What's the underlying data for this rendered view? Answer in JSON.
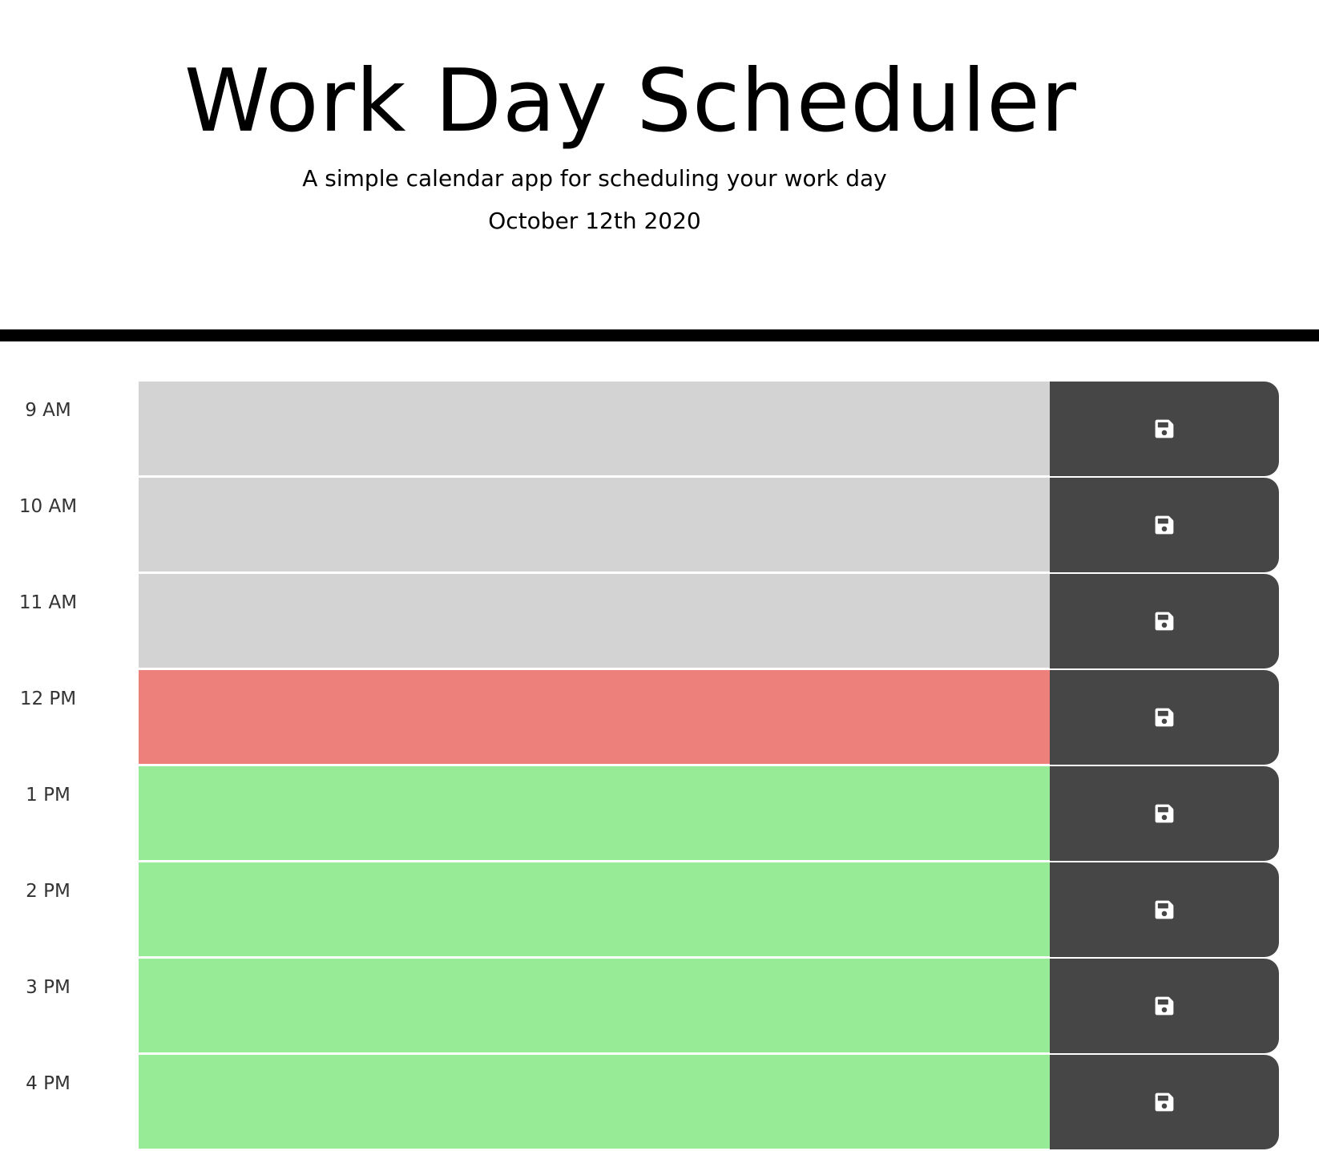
{
  "header": {
    "title": "Work Day Scheduler",
    "subtitle": "A simple calendar app for scheduling your work day",
    "current_day": "October 12th 2020"
  },
  "colors": {
    "past": "#d3d3d3",
    "present": "#ee807c",
    "future": "#97eb97",
    "save_button": "#464646"
  },
  "schedule": {
    "save_icon": "save-icon",
    "blocks": [
      {
        "hour": "9 AM",
        "text": "",
        "status": "past"
      },
      {
        "hour": "10 AM",
        "text": "",
        "status": "past"
      },
      {
        "hour": "11 AM",
        "text": "",
        "status": "past"
      },
      {
        "hour": "12 PM",
        "text": "",
        "status": "present"
      },
      {
        "hour": "1 PM",
        "text": "",
        "status": "future"
      },
      {
        "hour": "2 PM",
        "text": "",
        "status": "future"
      },
      {
        "hour": "3 PM",
        "text": "",
        "status": "future"
      },
      {
        "hour": "4 PM",
        "text": "",
        "status": "future"
      }
    ]
  }
}
